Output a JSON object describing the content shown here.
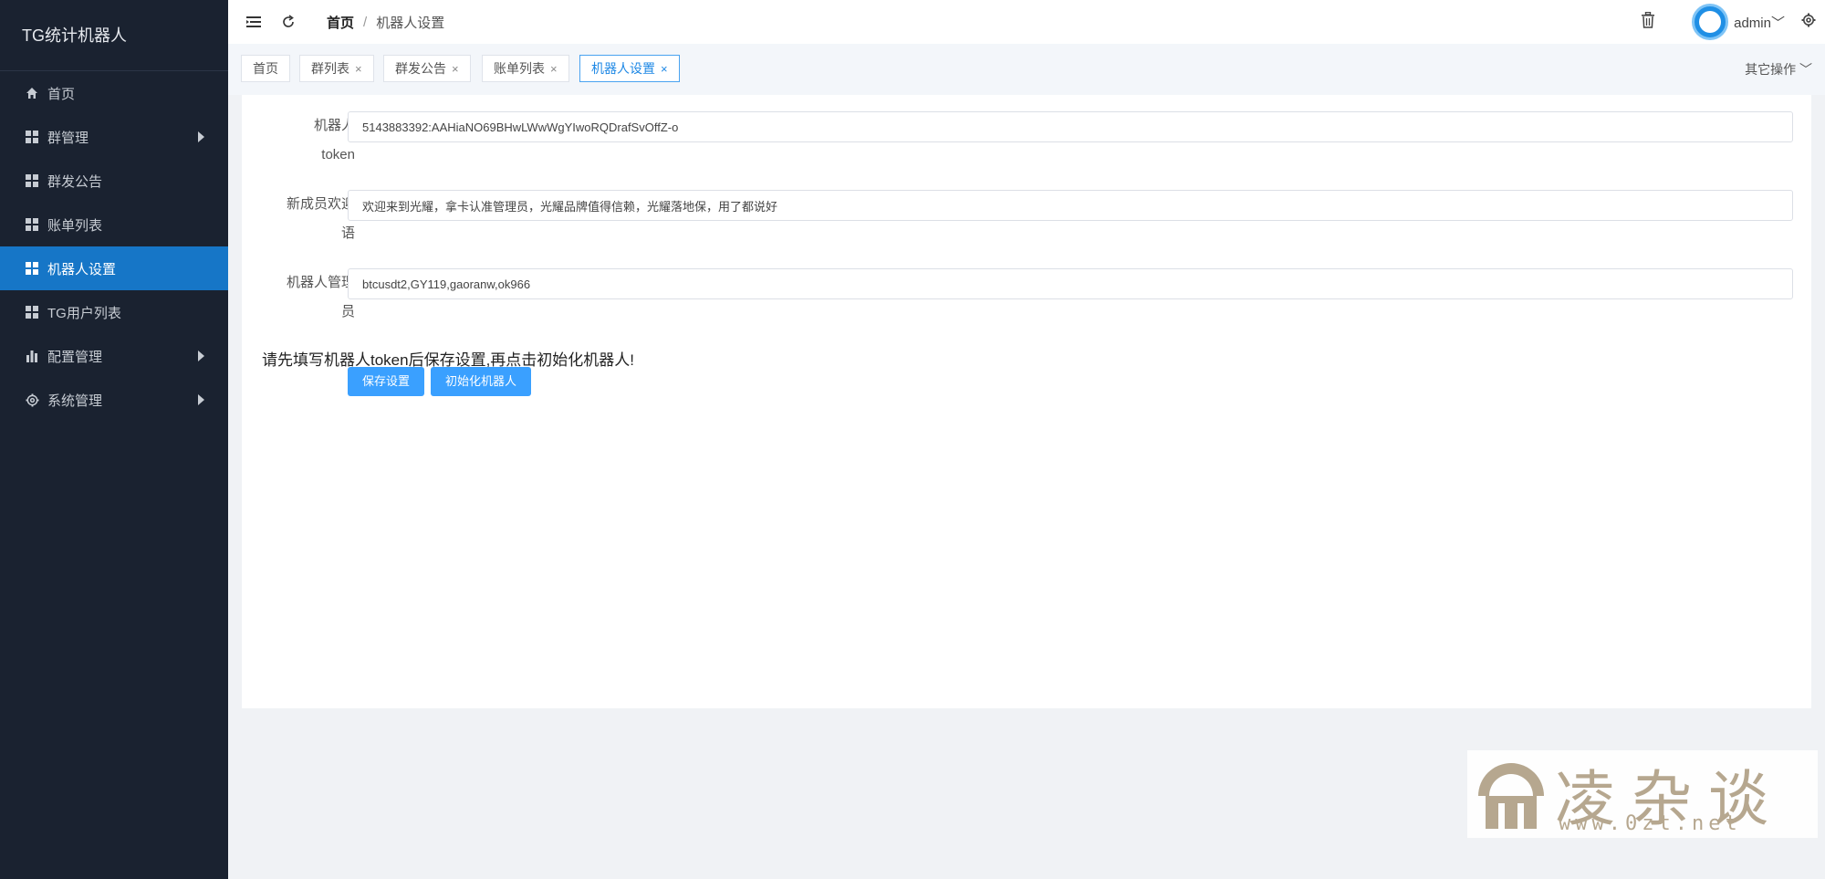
{
  "sidebar": {
    "title": "TG统计机器人",
    "items": [
      {
        "label": "首页",
        "icon": "home-icon",
        "has_arrow": false,
        "active": false
      },
      {
        "label": "群管理",
        "icon": "grid-icon",
        "has_arrow": true,
        "active": false
      },
      {
        "label": "群发公告",
        "icon": "grid-icon",
        "has_arrow": false,
        "active": false
      },
      {
        "label": "账单列表",
        "icon": "grid-icon",
        "has_arrow": false,
        "active": false
      },
      {
        "label": "机器人设置",
        "icon": "grid-icon",
        "has_arrow": false,
        "active": true
      },
      {
        "label": "TG用户列表",
        "icon": "grid-icon",
        "has_arrow": false,
        "active": false
      },
      {
        "label": "配置管理",
        "icon": "bar-chart-icon",
        "has_arrow": true,
        "active": false
      },
      {
        "label": "系统管理",
        "icon": "gear-icon",
        "has_arrow": true,
        "active": false
      }
    ]
  },
  "header": {
    "breadcrumb_home": "首页",
    "breadcrumb_sep": "/",
    "breadcrumb_current": "机器人设置",
    "username": "admin",
    "username_chevron": "﹀"
  },
  "tabs": {
    "items": [
      {
        "label": "首页",
        "closable": false,
        "active": false
      },
      {
        "label": "群列表",
        "closable": true,
        "active": false
      },
      {
        "label": "群发公告",
        "closable": true,
        "active": false
      },
      {
        "label": "账单列表",
        "closable": true,
        "active": false
      },
      {
        "label": "机器人设置",
        "closable": true,
        "active": true
      }
    ],
    "close_glyph": "×",
    "other_ops": "其它操作 ﹀"
  },
  "form": {
    "token_label_1": "机器人",
    "token_label_2": "token",
    "token_value": "5143883392:AAHiaNO69BHwLWwWgYIwoRQDrafSvOffZ-o",
    "welcome_label_1": "新成员欢迎",
    "welcome_label_2": "语",
    "welcome_value": "欢迎来到光耀，拿卡认准管理员，光耀品牌值得信赖，光耀落地保，用了都说好",
    "admins_label_1": "机器人管理",
    "admins_label_2": "员",
    "admins_value": "btcusdt2,GY119,gaoranw,ok966",
    "hint": "请先填写机器人token后保存设置,再点击初始化机器人!",
    "save_label": "保存设置",
    "init_label": "初始化机器人"
  },
  "watermark": {
    "text": "凌杂谈",
    "url": "www.0zt.net"
  },
  "colors": {
    "sidebar_bg": "#1a2230",
    "active_item": "#1676c7",
    "primary_button": "#3aa0ff",
    "watermark": "#b3a48a"
  }
}
